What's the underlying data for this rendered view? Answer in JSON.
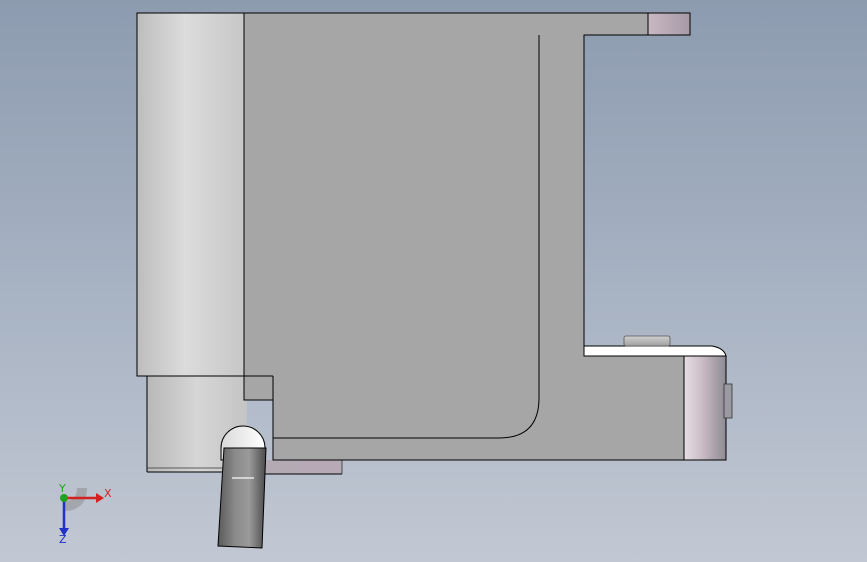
{
  "view": {
    "background_top": "#8d9bb0",
    "background_bottom": "#c2c8d3",
    "part_color": "#a6a6a6",
    "edge_color": "#000000"
  },
  "triad": {
    "x_label": "X",
    "y_label": "Y",
    "z_label": "Z",
    "x_color": "#d42020",
    "y_color": "#1fa31f",
    "z_color": "#2030c8"
  }
}
